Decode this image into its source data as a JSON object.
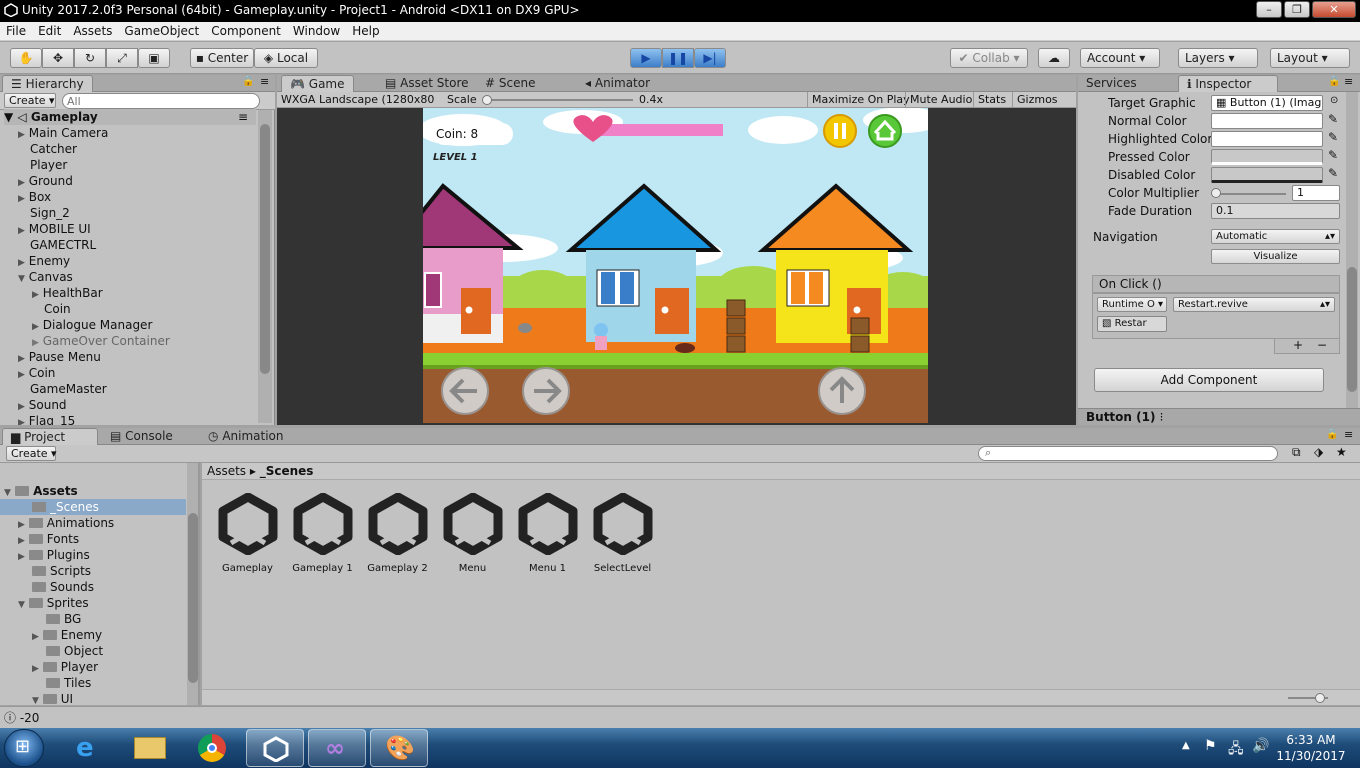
{
  "window": {
    "title": "Unity 2017.2.0f3 Personal (64bit) - Gameplay.unity - Project1 - Android <DX11 on DX9 GPU>"
  },
  "menu": [
    "File",
    "Edit",
    "Assets",
    "GameObject",
    "Component",
    "Window",
    "Help"
  ],
  "toolbar": {
    "center": "Center",
    "local": "Local",
    "collab": "Collab",
    "account": "Account",
    "layers": "Layers",
    "layout": "Layout"
  },
  "hierarchy": {
    "tab": "Hierarchy",
    "create": "Create",
    "search_placeholder": "All",
    "scene": "Gameplay",
    "items": [
      "Main Camera",
      "Catcher",
      "Player",
      "Ground",
      "Box",
      "Sign_2",
      "MOBILE UI",
      "GAMECTRL",
      "Enemy",
      "Canvas",
      "HealthBar",
      "Coin",
      "Dialogue Manager",
      "GameOver Container",
      "Pause Menu",
      "Coin",
      "GameMaster",
      "Sound",
      "Flag_15"
    ]
  },
  "center_tabs": {
    "game": "Game",
    "asset_store": "Asset Store",
    "scene": "Scene",
    "animator": "Animator"
  },
  "game_bar": {
    "resolution": "WXGA Landscape (1280x80",
    "scale_label": "Scale",
    "scale_value": "0.4x",
    "maximize": "Maximize On Play",
    "mute": "Mute Audio",
    "stats": "Stats",
    "gizmos": "Gizmos"
  },
  "game": {
    "coin": "Coin: 8",
    "level": "LEVEL 1"
  },
  "right_tabs": {
    "services": "Services",
    "inspector": "Inspector"
  },
  "inspector": {
    "target_graphic_label": "Target Graphic",
    "target_graphic_value": "Button (1) (Imag",
    "normal_color": "Normal Color",
    "highlighted_color": "Highlighted Color",
    "pressed_color": "Pressed Color",
    "disabled_color": "Disabled Color",
    "color_multiplier": "Color Multiplier",
    "color_multiplier_value": "1",
    "fade_duration": "Fade Duration",
    "fade_duration_value": "0.1",
    "navigation": "Navigation",
    "navigation_value": "Automatic",
    "visualize": "Visualize",
    "on_click": "On Click ()",
    "runtime": "Runtime O",
    "function": "Restart.revive",
    "object": "Restar",
    "add_component": "Add Component",
    "footer": "Button (1)"
  },
  "bottom_tabs": {
    "project": "Project",
    "console": "Console",
    "animation": "Animation"
  },
  "project": {
    "create": "Create",
    "breadcrumb_root": "Assets",
    "breadcrumb_leaf": "_Scenes",
    "tree": [
      "Assets",
      "_Scenes",
      "Animations",
      "Fonts",
      "Plugins",
      "Scripts",
      "Sounds",
      "Sprites",
      "BG",
      "Enemy",
      "Object",
      "Player",
      "Tiles",
      "UI"
    ],
    "assets": [
      "Gameplay",
      "Gameplay 1",
      "Gameplay 2",
      "Menu",
      "Menu 1",
      "SelectLevel"
    ]
  },
  "status": {
    "message": "-20"
  },
  "taskbar": {
    "time": "6:33 AM",
    "date": "11/30/2017"
  },
  "colors": {
    "accent_blue": "#3d7ec9",
    "panel": "#c2c2c2",
    "sky": "#bfe8f4"
  }
}
